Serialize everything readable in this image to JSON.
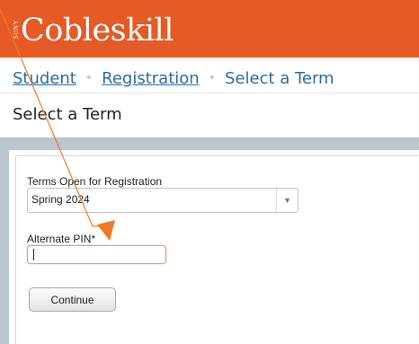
{
  "header": {
    "logo_prefix": "SUNY",
    "logo_text": "Cobleskill",
    "color": "#e55a25"
  },
  "breadcrumb": {
    "items": [
      {
        "label": "Student"
      },
      {
        "label": "Registration"
      },
      {
        "label": "Select a Term"
      }
    ],
    "separator": "•"
  },
  "page": {
    "title": "Select a Term"
  },
  "form": {
    "terms_label": "Terms Open for Registration",
    "terms_selected": "Spring 2024",
    "pin_label": "Alternate PIN*",
    "pin_value": "",
    "continue_label": "Continue"
  },
  "annotation": {
    "color": "#f07a28"
  },
  "icons": {
    "dropdown": "chevron-down-icon"
  }
}
